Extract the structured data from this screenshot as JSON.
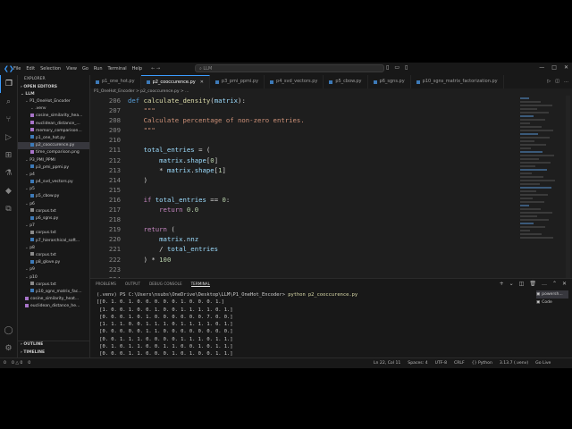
{
  "titlebar": {
    "menu": [
      "File",
      "Edit",
      "Selection",
      "View",
      "Go",
      "Run",
      "Terminal",
      "Help"
    ],
    "search_placeholder": "LLM"
  },
  "sidebar": {
    "title": "EXPLORER",
    "open_editors": "OPEN EDITORS",
    "root": "LLM",
    "items": [
      {
        "label": "P1_OneHot_Encoder",
        "depth": 1,
        "kind": "dir"
      },
      {
        "label": ".venv",
        "depth": 2,
        "kind": "dir"
      },
      {
        "label": "cosine_similarity_hea...",
        "depth": 2,
        "kind": "png"
      },
      {
        "label": "euclidean_distance_...",
        "depth": 2,
        "kind": "png"
      },
      {
        "label": "memory_comparison...",
        "depth": 2,
        "kind": "png"
      },
      {
        "label": "p1_one_hot.py",
        "depth": 2,
        "kind": "py"
      },
      {
        "label": "p2_cooccurence.py",
        "depth": 2,
        "kind": "py",
        "selected": true
      },
      {
        "label": "time_comparison.png",
        "depth": 2,
        "kind": "png"
      },
      {
        "label": "P3_PMI_PPMI",
        "depth": 1,
        "kind": "dir"
      },
      {
        "label": "p3_pmi_ppmi.py",
        "depth": 2,
        "kind": "py"
      },
      {
        "label": "p4",
        "depth": 1,
        "kind": "dir"
      },
      {
        "label": "p4_svd_vectors.py",
        "depth": 2,
        "kind": "py"
      },
      {
        "label": "p5",
        "depth": 1,
        "kind": "dir"
      },
      {
        "label": "p5_cbow.py",
        "depth": 2,
        "kind": "py"
      },
      {
        "label": "p6",
        "depth": 1,
        "kind": "dir"
      },
      {
        "label": "corpus.txt",
        "depth": 2,
        "kind": "txt"
      },
      {
        "label": "p6_sgns.py",
        "depth": 2,
        "kind": "py"
      },
      {
        "label": "p7",
        "depth": 1,
        "kind": "dir"
      },
      {
        "label": "corpus.txt",
        "depth": 2,
        "kind": "txt"
      },
      {
        "label": "p7_hierarchical_soft...",
        "depth": 2,
        "kind": "py"
      },
      {
        "label": "p8",
        "depth": 1,
        "kind": "dir"
      },
      {
        "label": "corpus.txt",
        "depth": 2,
        "kind": "txt"
      },
      {
        "label": "p8_glove.py",
        "depth": 2,
        "kind": "py"
      },
      {
        "label": "p9",
        "depth": 1,
        "kind": "dir"
      },
      {
        "label": "p10",
        "depth": 1,
        "kind": "dir"
      },
      {
        "label": "corpus.txt",
        "depth": 2,
        "kind": "txt"
      },
      {
        "label": "p10_sgns_matrix_fac...",
        "depth": 2,
        "kind": "py"
      },
      {
        "label": "cosine_similarity_heat...",
        "depth": 1,
        "kind": "png"
      },
      {
        "label": "euclidean_distance_he...",
        "depth": 1,
        "kind": "png"
      }
    ],
    "outline": "OUTLINE",
    "timeline": "TIMELINE"
  },
  "tabs": [
    {
      "label": "p1_one_hot.py",
      "active": false
    },
    {
      "label": "p2_cooccurence.py",
      "active": true
    },
    {
      "label": "p3_pmi_ppmi.py",
      "active": false
    },
    {
      "label": "p4_svd_vectors.py",
      "active": false
    },
    {
      "label": "p5_cbow.py",
      "active": false
    },
    {
      "label": "p6_sgns.py",
      "active": false
    },
    {
      "label": "p10_sgns_matrix_factorization.py",
      "active": false
    }
  ],
  "breadcrumb": "P1_OneHot_Encoder > p2_cooccurence.py > ...",
  "editor": {
    "lines": [
      {
        "n": "206",
        "text": "def calculate_density(matrix):"
      },
      {
        "n": "207",
        "text": "    \"\"\""
      },
      {
        "n": "208",
        "text": "    Calculate percentage of non-zero entries."
      },
      {
        "n": "209",
        "text": "    \"\"\""
      },
      {
        "n": "210",
        "text": ""
      },
      {
        "n": "211",
        "text": "    total_entries = ("
      },
      {
        "n": "212",
        "text": "        matrix.shape[0]"
      },
      {
        "n": "213",
        "text": "        * matrix.shape[1]"
      },
      {
        "n": "214",
        "text": "    )"
      },
      {
        "n": "215",
        "text": ""
      },
      {
        "n": "216",
        "text": "    if total_entries == 0:"
      },
      {
        "n": "217",
        "text": "        return 0.0"
      },
      {
        "n": "218",
        "text": ""
      },
      {
        "n": "219",
        "text": "    return ("
      },
      {
        "n": "220",
        "text": "        matrix.nnz"
      },
      {
        "n": "221",
        "text": "        / total_entries"
      },
      {
        "n": "222",
        "text": "    ) * 100"
      },
      {
        "n": "223",
        "text": ""
      },
      {
        "n": "224",
        "text": ""
      }
    ]
  },
  "panel": {
    "tabs": [
      "PROBLEMS",
      "OUTPUT",
      "DEBUG CONSOLE",
      "TERMINAL"
    ],
    "active_tab": "TERMINAL",
    "prompt": "(.venv) PS C:\\Users\\nsubs\\OneDrive\\Desktop\\LLM\\P1_OneHot_Encoder>",
    "command": "python p2_cooccurence.py",
    "output": [
      "[[0. 1. 0. 1. 0. 0. 0. 0. 0. 1. 0. 0. 0. 1.]",
      " [1. 0. 0. 1. 0. 0. 1. 0. 0. 1. 1. 1. 1. 0. 1.]",
      " [0. 0. 0. 1. 0. 1. 0. 0. 0. 0. 0. 0. 7. 0. 0.]",
      " [1. 1. 1. 0. 0. 1. 1. 1. 0. 1. 1. 1. 1. 0. 1.]",
      " [0. 0. 0. 0. 0. 1. 1. 0. 0. 0. 0. 0. 0. 0. 0.]",
      " [0. 0. 1. 1. 1. 0. 0. 0. 0. 1. 1. 1. 0. 1. 1.]",
      " [0. 1. 0. 1. 1. 0. 0. 1. 1. 0. 0. 1. 0. 1. 1.]",
      " [0. 0. 0. 1. 1. 0. 0. 0. 1. 0. 1. 0. 0. 1. 1.]",
      " [0. 0. 0. 0. 0. 0. 1. 0. 0. 0. 0. 1. 0. 1. 0.]"
    ],
    "side_items": [
      "powersh...",
      "Code"
    ]
  },
  "status": {
    "left": [
      "0",
      "0 △ 0",
      "0"
    ],
    "right": [
      "Ln 22, Col 11",
      "Spaces: 4",
      "UTF-8",
      "CRLF",
      "{} Python",
      "3.13.7 (.venv)",
      "Go Live"
    ]
  }
}
